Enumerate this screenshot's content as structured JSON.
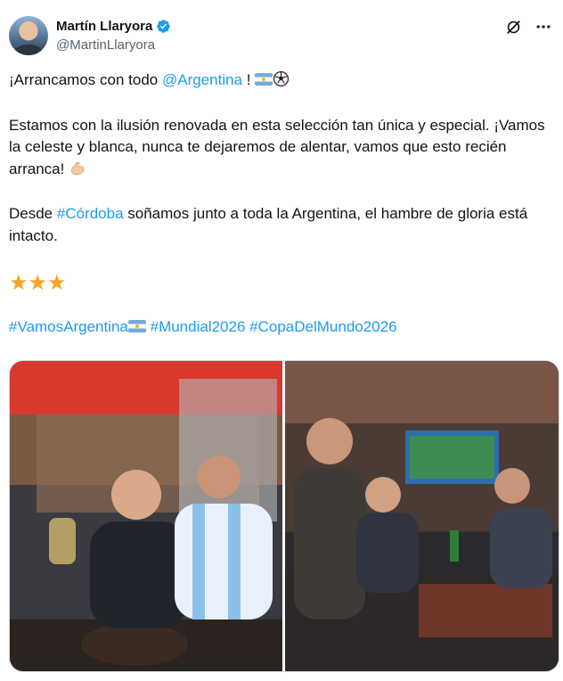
{
  "author": {
    "display_name": "Martín Llaryora",
    "handle": "@MartinLlaryora",
    "verified": true
  },
  "icons": {
    "avatar": "avatar",
    "verified": "verified-badge-icon",
    "grok": "grok-icon",
    "more": "more-options-icon"
  },
  "tweet": {
    "line1_prefix": "¡Arrancamos con todo ",
    "line1_mention": "@Argentina",
    "line1_suffix": " ! ",
    "para2": "Estamos con la ilusión renovada en esta selección tan única y especial. ¡Vamos la celeste y blanca, nunca te dejaremos de alentar, vamos que esto recién arranca! ",
    "para3_prefix": "Desde ",
    "para3_hashtag": "#Córdoba",
    "para3_suffix": " soñamos junto a toda la Argentina, el hambre de gloria está intacto.",
    "stars": "★★★",
    "hashtag1": "#VamosArgentina",
    "hashtag2": "#Mundial2026",
    "hashtag3": "#CopaDelMundo2026"
  },
  "colors": {
    "link": "#1d9bf0",
    "verified": "#1d9bf0",
    "star": "#f4a521",
    "muted": "#536471"
  }
}
